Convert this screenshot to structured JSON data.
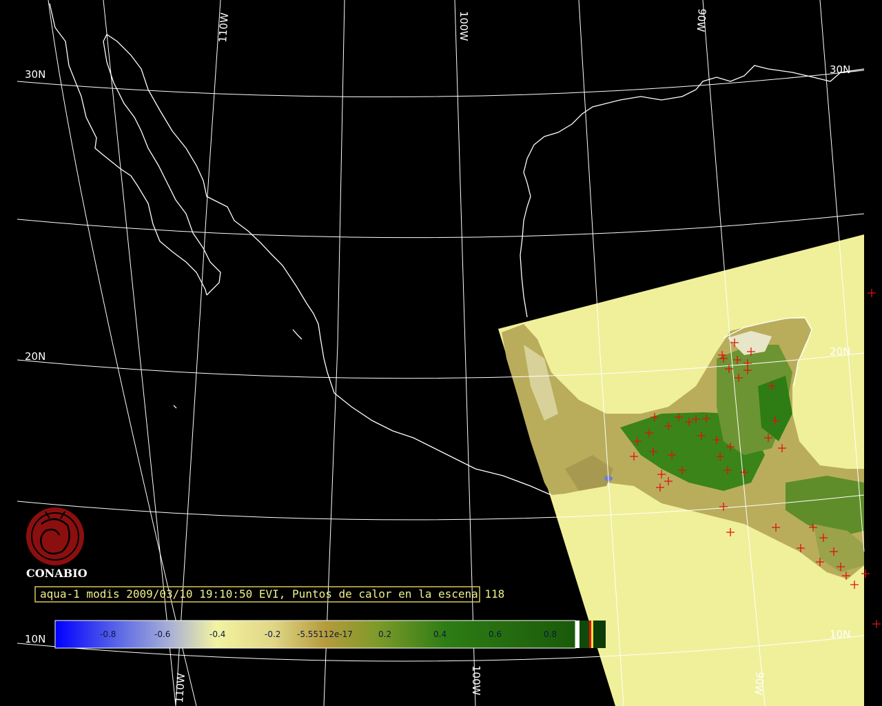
{
  "graticule": {
    "lat_labels": [
      "30N",
      "20N",
      "10N",
      "30N",
      "20N",
      "10N"
    ],
    "lon_labels": [
      "110W",
      "100W",
      "90W",
      "110W",
      "100W",
      "90W"
    ]
  },
  "logo": {
    "text": "CONABIO",
    "icon": "conabio-emblem-icon",
    "color": "#8b0f0f"
  },
  "caption": {
    "text": "aqua-1 modis 2009/03/10 19:10:50 EVI, Puntos de calor en la escena 118"
  },
  "colorbar": {
    "labels": [
      "-0.8",
      "-0.6",
      "-0.4",
      "-0.2",
      "-5.55112e-17",
      "0.2",
      "0.4",
      "0.6",
      "0.8"
    ],
    "gradient_colors": [
      "#0000ff",
      "#9ea6d8",
      "#f3f3a0",
      "#d8cf78",
      "#b59b3b",
      "#8d9a2a",
      "#2e7d14",
      "#1a5a0a"
    ]
  },
  "colors": {
    "background": "#000000",
    "swath": "#f0f09a",
    "coastline": "#ffffff",
    "fire_marker": "#e01010",
    "vegetation": "#2f7d16"
  }
}
